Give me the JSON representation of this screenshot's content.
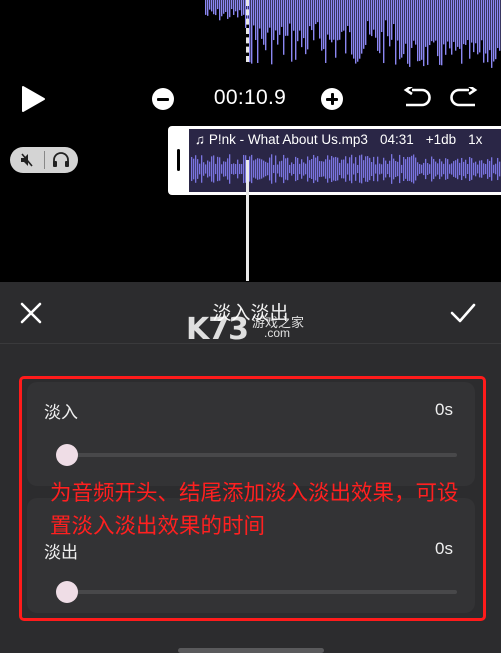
{
  "top_waveform": {
    "color": "#8b87f2"
  },
  "transport": {
    "play_icon": "play-icon",
    "zoom_out_icon": "minus-circle-icon",
    "time": "00:10.9",
    "zoom_in_icon": "plus-circle-icon",
    "undo_icon": "undo-icon",
    "redo_icon": "redo-icon"
  },
  "track": {
    "mute_icon": "speaker-mute-icon",
    "headphone_icon": "headphones-icon",
    "clip": {
      "name": "♫ P!nk - What About Us.mp3",
      "duration": "04:31",
      "gain": "+1db",
      "speed": "1x",
      "wave_color": "#7a74e0"
    }
  },
  "panel": {
    "title": "淡入淡出",
    "close_icon": "close-icon",
    "confirm_icon": "checkmark-icon",
    "fade_in": {
      "label": "淡入",
      "value": "0s",
      "level": 0
    },
    "fade_out": {
      "label": "淡出",
      "value": "0s",
      "level": 0
    }
  },
  "watermark": {
    "logo": "K73",
    "cn": "游戏之家",
    "domain": ".com"
  },
  "annotation": {
    "text": "为音频开头、结尾添加淡入淡出效果，可设置淡入淡出效果的时间",
    "color": "#ff2020"
  }
}
